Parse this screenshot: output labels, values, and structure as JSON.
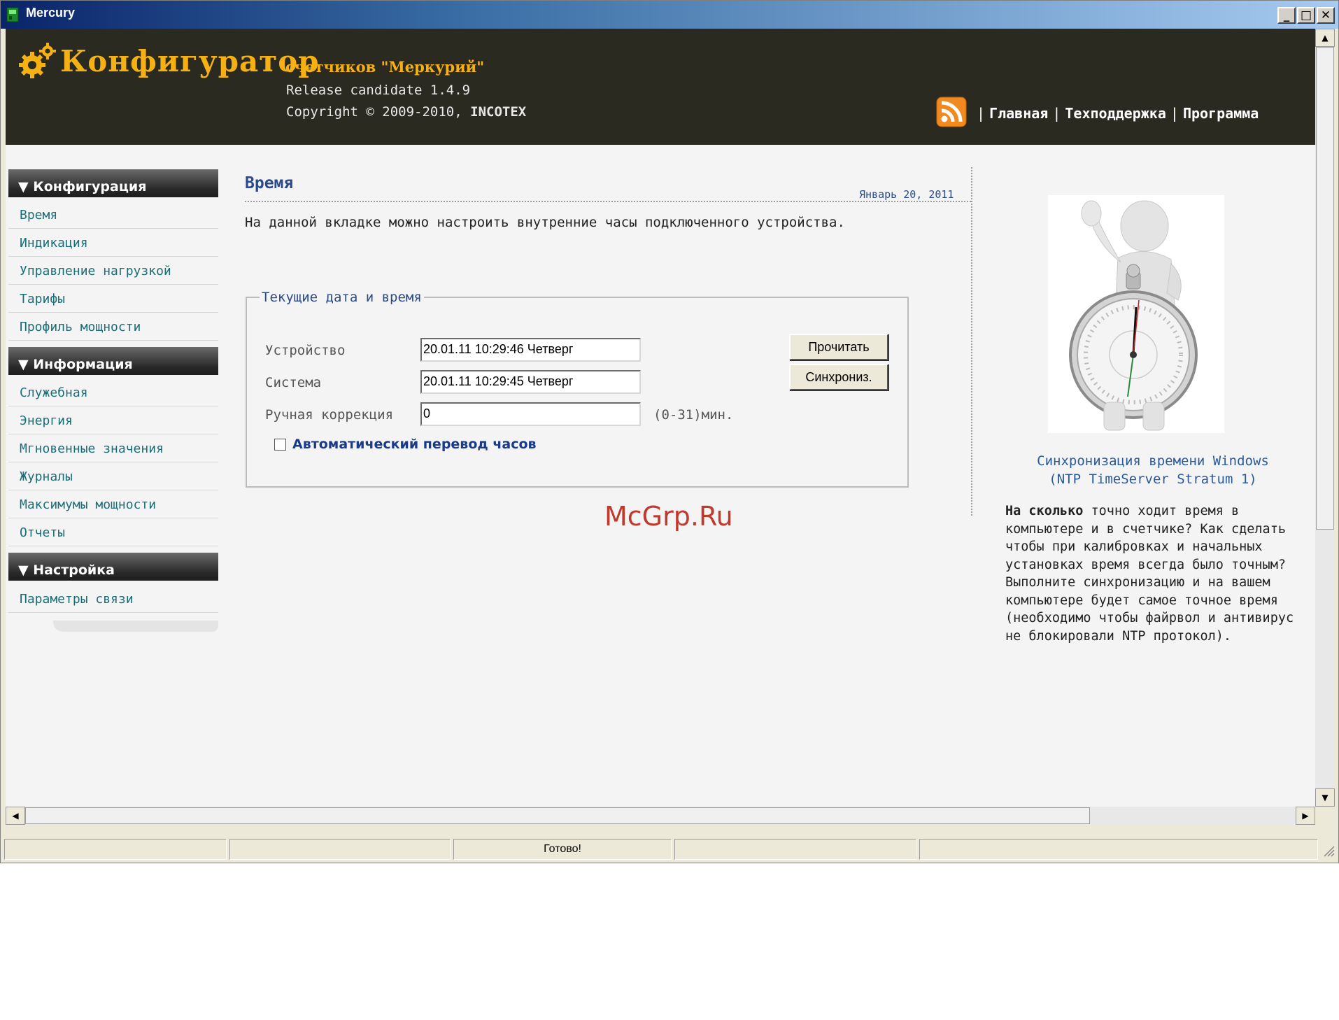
{
  "window": {
    "title": "Mercury"
  },
  "header": {
    "brand_title": "Конфигуратор",
    "brand_subtitle": "счетчиков \"Меркурий\"",
    "release": "Release candidate 1.4.9",
    "copyright_prefix": "Copyright © 2009-2010,",
    "copyright_company": "INCOTEX",
    "nav": [
      {
        "label": "Главная"
      },
      {
        "label": "Техподдержка"
      },
      {
        "label": "Программа"
      }
    ],
    "nav_separator": "|"
  },
  "sidebar": {
    "sections": [
      {
        "title": "▼ Конфигурация",
        "items": [
          "Время",
          "Индикация",
          "Управление нагрузкой",
          "Тарифы",
          "Профиль мощности"
        ]
      },
      {
        "title": "▼ Информация",
        "items": [
          "Служебная",
          "Энергия",
          "Мгновенные значения",
          "Журналы",
          "Максимумы мощности",
          "Отчеты"
        ]
      },
      {
        "title": "▼ Настройка",
        "items": [
          "Параметры связи"
        ]
      }
    ]
  },
  "main": {
    "title": "Время",
    "date": "Январь 20, 2011",
    "intro": "На данной вкладке можно настроить внутренние часы подключенного устройства.",
    "fieldset_legend": "Текущие дата и время",
    "fields": {
      "device_label": "Устройство",
      "device_value": "20.01.11  10:29:46  Четверг",
      "system_label": "Система",
      "system_value": "20.01.11  10:29:45  Четверг",
      "correction_label": "Ручная коррекция",
      "correction_value": "0",
      "correction_hint": "(0-31)мин."
    },
    "buttons": {
      "read": "Прочитать",
      "sync": "Синхрониз."
    },
    "auto_dst_label": "Автоматический перевод часов",
    "auto_dst_checked": false,
    "watermark": "McGrp.Ru"
  },
  "aside": {
    "ntp_link_line1": "Синхронизация времени Windows",
    "ntp_link_line2": "(NTP TimeServer Stratum 1)",
    "promo_bold": "На сколько",
    "promo_text": " точно ходит время в компьютере и в счетчике? Как сделать чтобы при калибровках и начальных установках время всегда было точным? Выполните синхронизацию и на вашем компьютере будет самое точное время (необходимо чтобы файрвол и антивирус не блокировали NTP протокол)."
  },
  "statusbar": {
    "cells": [
      "",
      "",
      "Готово!",
      "",
      ""
    ]
  },
  "colors": {
    "header_bg": "#2a2a20",
    "brand_gold": "#f5b014",
    "link_teal": "#1a6e78",
    "heading_blue": "#2a4a8a",
    "watermark_red": "#c0392b"
  }
}
